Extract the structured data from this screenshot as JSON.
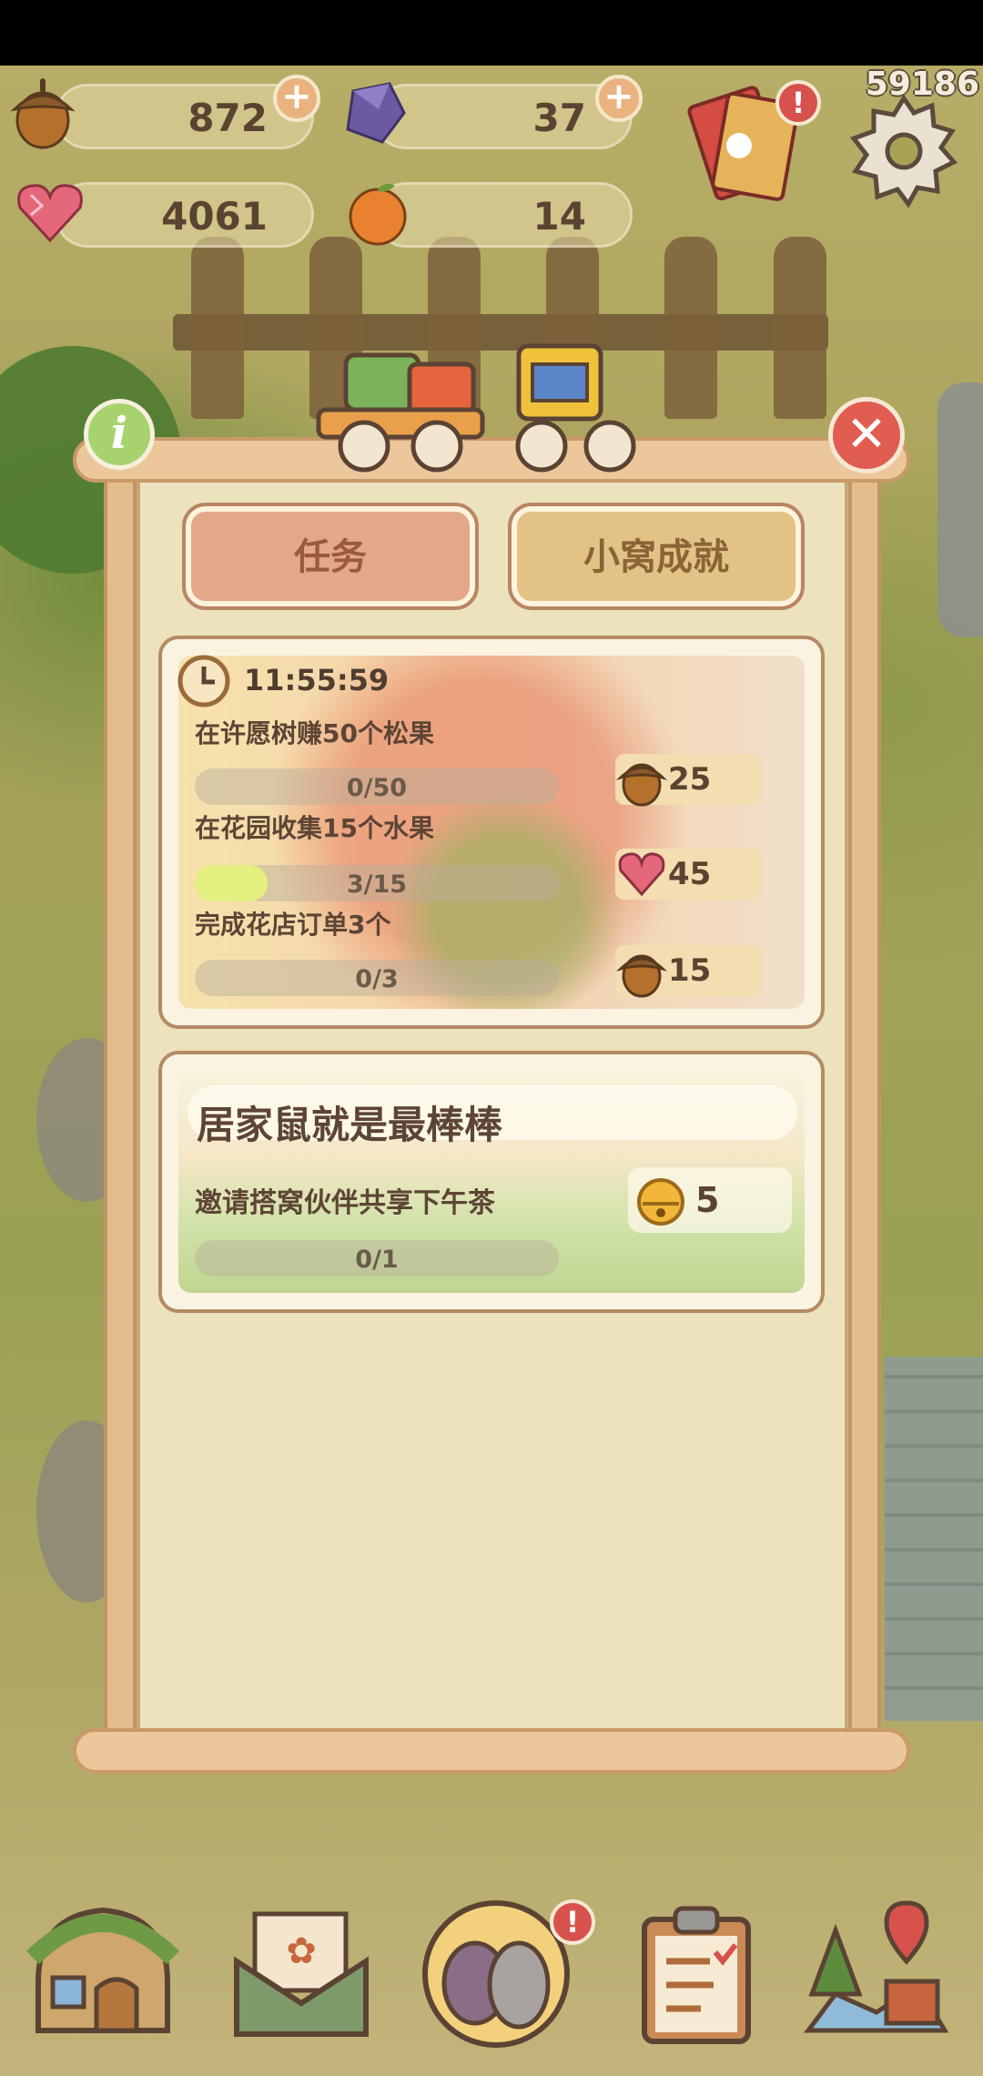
{
  "counter": "59186",
  "currencies": [
    {
      "name": "acorn",
      "icon": "acorn-icon",
      "value": "872",
      "has_plus": true
    },
    {
      "name": "gem",
      "icon": "purple-gem-icon",
      "value": "37",
      "has_plus": true
    },
    {
      "name": "heart",
      "icon": "heart-gem-icon",
      "value": "4061",
      "has_plus": false
    },
    {
      "name": "fruit",
      "icon": "orange-icon",
      "value": "14",
      "has_plus": false
    }
  ],
  "tabs": [
    {
      "label": "任务",
      "active": true
    },
    {
      "label": "小窝成就",
      "active": false
    }
  ],
  "daily": {
    "timer": "11:55:59",
    "tasks": [
      {
        "title": "在许愿树赚50个松果",
        "progress_text": "0/50",
        "progress": 0.0,
        "reward_icon": "acorn-icon",
        "reward": "25"
      },
      {
        "title": "在花园收集15个水果",
        "progress_text": "3/15",
        "progress": 0.2,
        "reward_icon": "heart-gem-icon",
        "reward": "45"
      },
      {
        "title": "完成花店订单3个",
        "progress_text": "0/3",
        "progress": 0.0,
        "reward_icon": "acorn-icon",
        "reward": "15"
      }
    ]
  },
  "achievement": {
    "title": "居家鼠就是最棒棒",
    "task": "邀请搭窝伙伴共享下午茶",
    "progress_text": "0/1",
    "progress": 0.0,
    "reward_icon": "bell-icon",
    "reward": "5"
  },
  "bottom_nav": [
    {
      "name": "home",
      "icon": "house-icon"
    },
    {
      "name": "mail",
      "icon": "letter-icon"
    },
    {
      "name": "friends",
      "icon": "friends-icon",
      "alert": "!"
    },
    {
      "name": "tasks",
      "icon": "clipboard-icon"
    },
    {
      "name": "map",
      "icon": "map-icon"
    }
  ],
  "alerts": {
    "gift": "!",
    "friends": "!"
  },
  "colors": {
    "panel_bg": "#ece2bd",
    "tab_active": "#e3a887",
    "tab_inactive": "#e3c285",
    "progress_fill": "#e3f080",
    "alert_red": "#d8524d"
  }
}
